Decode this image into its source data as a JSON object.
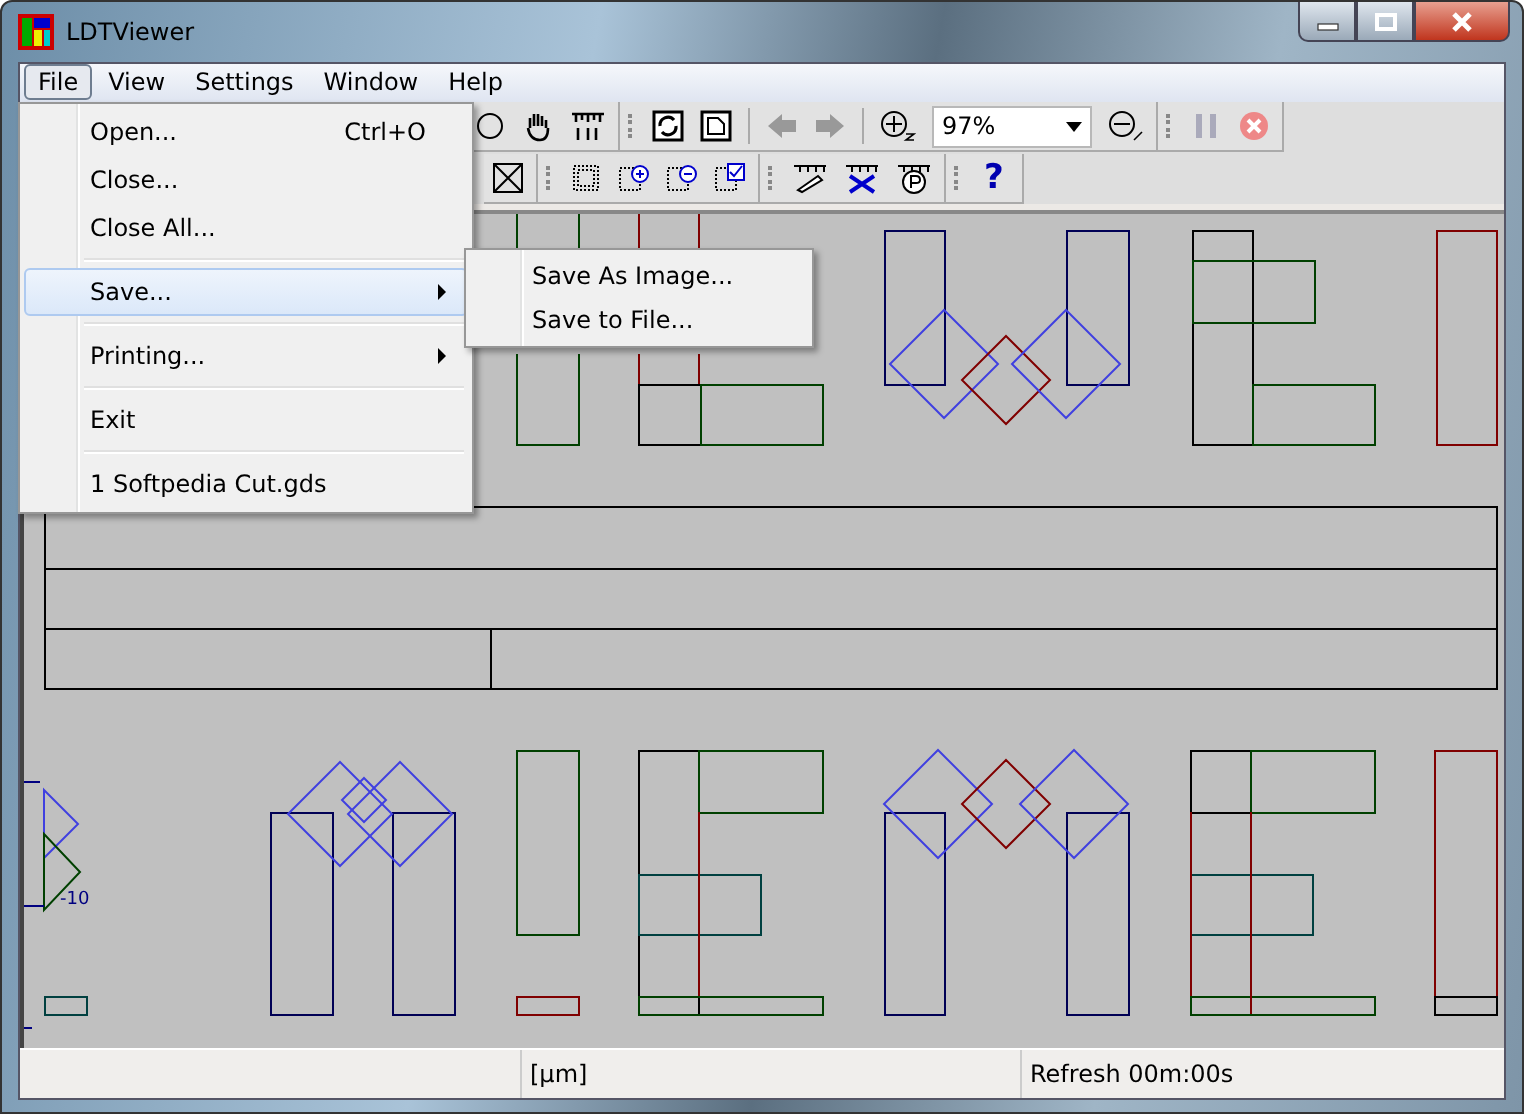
{
  "window": {
    "title": "LDTViewer"
  },
  "menubar": [
    {
      "label": "File",
      "selected": true
    },
    {
      "label": "View",
      "selected": false
    },
    {
      "label": "Settings",
      "selected": false
    },
    {
      "label": "Window",
      "selected": false
    },
    {
      "label": "Help",
      "selected": false
    }
  ],
  "file_menu": [
    {
      "kind": "item",
      "label": "Open...",
      "shortcut": "Ctrl+O",
      "selected": false
    },
    {
      "kind": "item",
      "label": "Close...",
      "selected": false
    },
    {
      "kind": "item",
      "label": "Close All...",
      "selected": false
    },
    {
      "kind": "separator"
    },
    {
      "kind": "submenu",
      "label": "Save...",
      "selected": true
    },
    {
      "kind": "separator"
    },
    {
      "kind": "submenu",
      "label": "Printing...",
      "selected": false
    },
    {
      "kind": "separator"
    },
    {
      "kind": "item",
      "label": "Exit",
      "selected": false
    },
    {
      "kind": "separator"
    },
    {
      "kind": "item",
      "label": "1 Softpedia Cut.gds",
      "selected": false
    }
  ],
  "save_submenu": [
    {
      "label": "Save As Image..."
    },
    {
      "label": "Save to File..."
    }
  ],
  "toolbar": {
    "back_disabled": true,
    "forward_disabled": true,
    "zoom_value": "97%",
    "help_glyph": "?"
  },
  "canvas": {
    "axis_label": "-10"
  },
  "status_bar": [
    {
      "text": "[µm]"
    },
    {
      "text": "Refresh 00m:00s"
    }
  ]
}
